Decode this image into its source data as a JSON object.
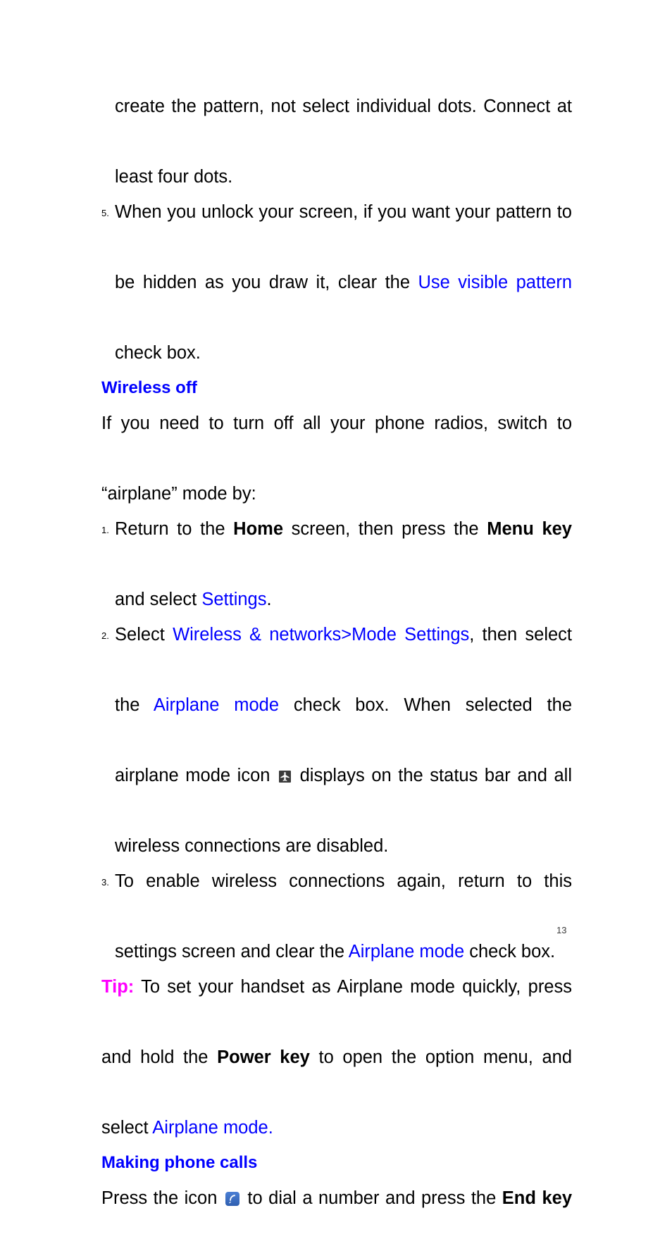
{
  "document": {
    "page_number": "13",
    "colors": {
      "link_blue": "#0000ff",
      "heading_blue": "#0000ff",
      "tip_magenta": "#ff00ff",
      "body_black": "#000000"
    }
  },
  "blocks": {
    "item5_continuation": {
      "text": "create the pattern, not select individual dots. Connect at"
    },
    "item5_continuation_2": {
      "text": "least four dots."
    },
    "item5": {
      "marker": "5.",
      "line1": "When you unlock your screen, if you want your pattern to",
      "line2_a": "be hidden as you draw it, clear the ",
      "line2_link": "Use visible pattern",
      "line3": "check box."
    },
    "heading_wireless_off": {
      "text": "Wireless off"
    },
    "intro_paragraph": {
      "line1": "If you need to turn off all your phone radios, switch to",
      "line2": "“airplane” mode by:"
    },
    "item1": {
      "marker": "1.",
      "part_a": "Return to the ",
      "bold_home": "Home",
      "part_b": " screen, then press the ",
      "bold_menu_key": "Menu key",
      "part_c": "and select ",
      "link_settings": "Settings",
      "part_d": "."
    },
    "item2": {
      "marker": "2.",
      "part_a": "Select ",
      "link_wireless_networks": "Wireless & networks>Mode Settings",
      "part_b": ", then select",
      "part_c": "the ",
      "link_airplane_mode": "Airplane mode",
      "part_d": " check box. When selected the",
      "part_e": "airplane mode icon ",
      "icon_name": "airplane-mode-status-icon",
      "part_f": " displays on the status bar and all",
      "part_g": "wireless connections are disabled."
    },
    "item3": {
      "marker": "3.",
      "part_a": "To enable wireless connections again, return to this",
      "part_b": "settings screen and clear the ",
      "link_airplane_mode": "Airplane mode",
      "part_c": " check box."
    },
    "tip": {
      "label": "Tip:",
      "part_a": " To set your handset as Airplane mode quickly, press",
      "part_b": "and hold the ",
      "bold_power_key": "Power key",
      "part_c": " to open the option menu, and",
      "part_d": "select ",
      "link_airplane_mode": "Airplane mode."
    },
    "heading_making_phone_calls": {
      "text": "Making phone calls"
    },
    "closing_paragraph": {
      "part_a": "Press the icon ",
      "icon_name": "dial-phone-icon",
      "part_b": " to dial a number and press the ",
      "bold_end_key": "End key"
    }
  }
}
